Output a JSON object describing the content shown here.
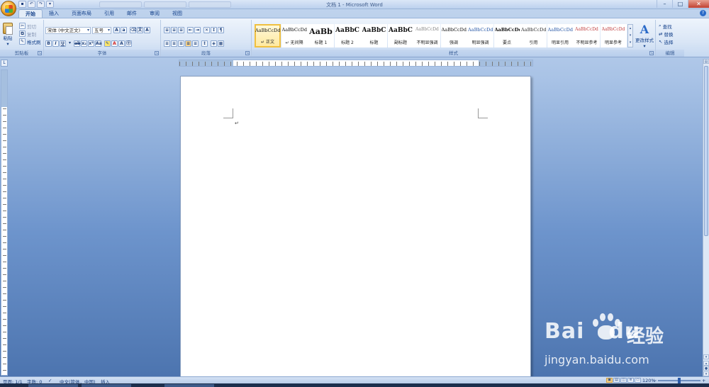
{
  "window": {
    "title": "文档 1 - Microsoft Word"
  },
  "tabs": [
    "开始",
    "插入",
    "页面布局",
    "引用",
    "邮件",
    "审阅",
    "视图"
  ],
  "clipboard": {
    "paste": "粘贴",
    "cut": "剪切",
    "copy": "复制",
    "format_painter": "格式刷",
    "group": "剪贴板"
  },
  "font": {
    "name": "宋体 (中文正文)",
    "size": "五号",
    "group": "字体"
  },
  "paragraph": {
    "group": "段落"
  },
  "styles": {
    "group": "样式",
    "items": [
      {
        "sample": "AaBbCcDd",
        "label": "↵ 正文",
        "selected": true
      },
      {
        "sample": "AaBbCcDd",
        "label": "↵ 无间隔"
      },
      {
        "sample": "AaBb",
        "label": "标题 1"
      },
      {
        "sample": "AaBbC",
        "label": "标题 2"
      },
      {
        "sample": "AaBbC",
        "label": "标题"
      },
      {
        "sample": "AaBbC",
        "label": "副标题"
      },
      {
        "sample": "AaBbCcDd",
        "label": "不明显强调"
      },
      {
        "sample": "AaBbCcDd",
        "label": "强调"
      },
      {
        "sample": "AaBbCcDd",
        "label": "明显强调"
      },
      {
        "sample": "AaBbCcDd",
        "label": "要点"
      },
      {
        "sample": "AaBbCcDd",
        "label": "引用"
      },
      {
        "sample": "AaBbCcDd",
        "label": "明显引用"
      },
      {
        "sample": "AaBbCcDd",
        "label": "不明显参考"
      },
      {
        "sample": "AaBbCcDd",
        "label": "明显参考"
      }
    ],
    "change_styles": "更改样式"
  },
  "editing": {
    "find": "查找",
    "replace": "替换",
    "select": "选择",
    "group": "编辑"
  },
  "status": {
    "page": "页面: 1/1",
    "words": "字数: 0",
    "language": "中文(简体，中国)",
    "mode": "插入",
    "zoom": "120%"
  },
  "watermark": {
    "brand": "Bai",
    "brand2": "du",
    "jy": "经验",
    "url": "jingyan.baidu.com"
  },
  "colors": {
    "accent": "#2a6ac8",
    "ribbon": "#dae6f6",
    "selected_style": "#f0c040"
  }
}
